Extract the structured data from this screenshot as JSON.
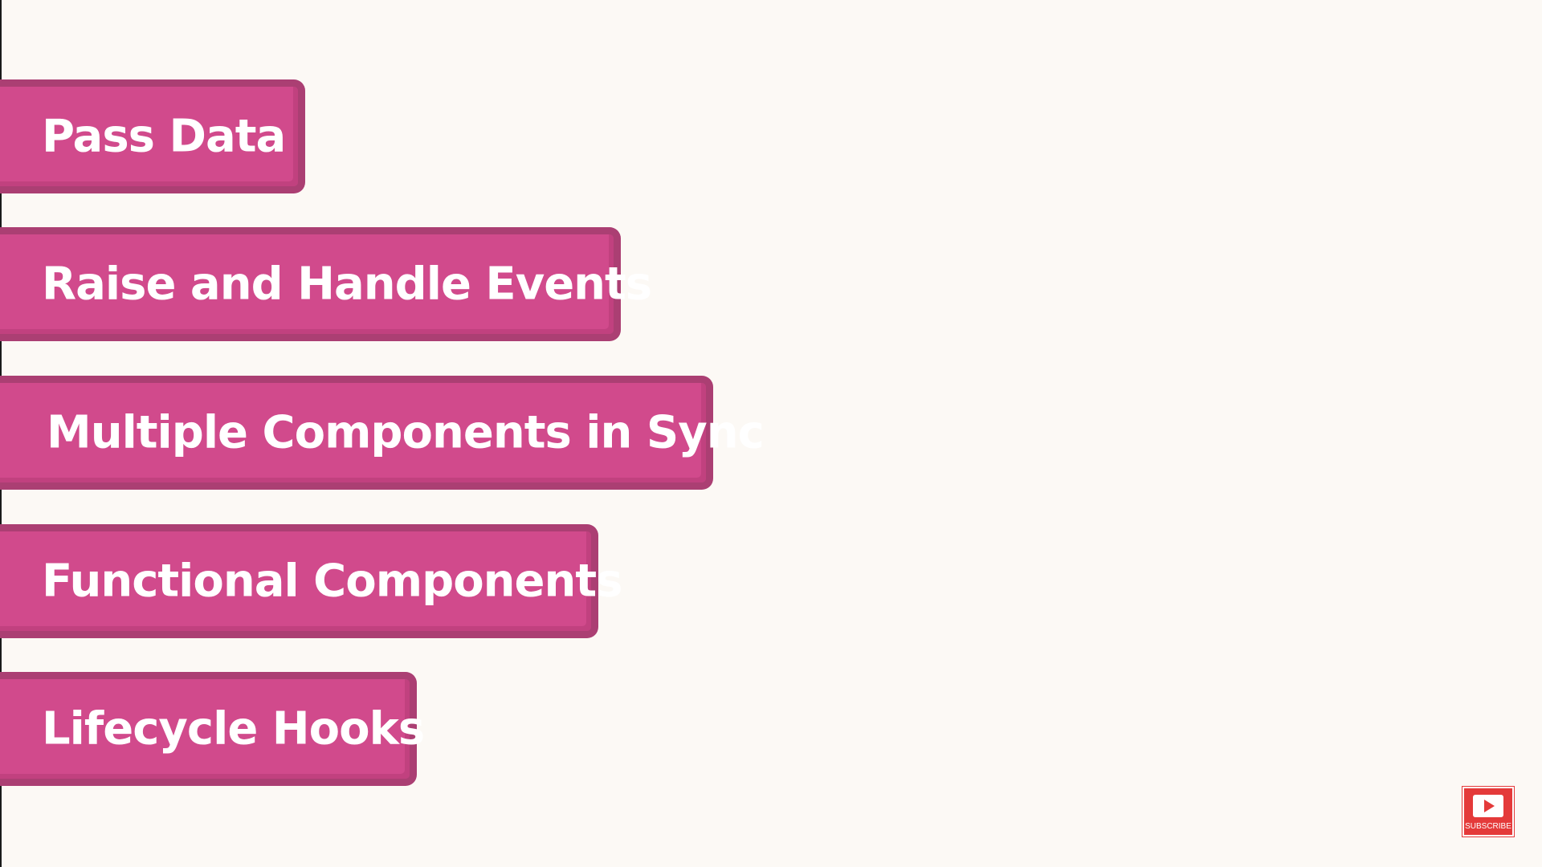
{
  "topics": [
    {
      "label": "Pass Data"
    },
    {
      "label": "Raise and Handle Events"
    },
    {
      "label": "Multiple Components in Sync"
    },
    {
      "label": "Functional Components"
    },
    {
      "label": "Lifecycle Hooks"
    }
  ],
  "subscribe": {
    "label": "SUBSCRIBE",
    "icon": "play-icon"
  },
  "colors": {
    "background": "#fcf9f5",
    "topic_fill": "#d14a8c",
    "topic_border": "#ab3f73",
    "subscribe": "#e43a3a"
  }
}
